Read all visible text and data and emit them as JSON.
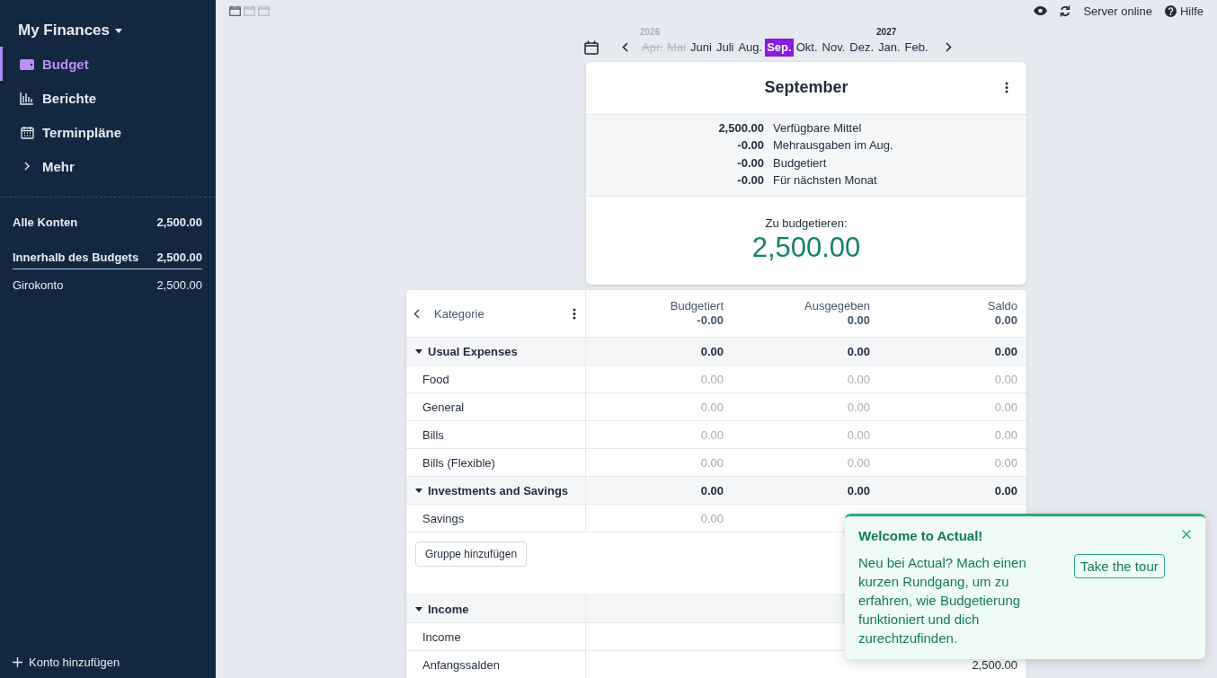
{
  "sidebar": {
    "title": "My Finances",
    "nav": [
      {
        "label": "Budget",
        "selected": true
      },
      {
        "label": "Berichte",
        "selected": false
      },
      {
        "label": "Terminpläne",
        "selected": false
      },
      {
        "label": "Mehr",
        "selected": false
      }
    ],
    "accounts": [
      {
        "name": "Alle Konten",
        "balance": "2,500.00",
        "kind": "total"
      },
      {
        "name": "Innerhalb des Budgets",
        "balance": "2,500.00",
        "kind": "group"
      },
      {
        "name": "Girokonto",
        "balance": "2,500.00",
        "kind": "account"
      }
    ],
    "add_account": "Konto hinzufügen"
  },
  "view_icons": [
    {
      "selected": true
    },
    {
      "selected": false
    },
    {
      "selected": false
    }
  ],
  "toolbar": {
    "server_status": "Server online",
    "help": "Hilfe"
  },
  "month_picker": {
    "months": [
      {
        "label": "Apr.",
        "year": "2026",
        "disabled": true,
        "selected": false
      },
      {
        "label": "Mai",
        "disabled": true,
        "selected": false
      },
      {
        "label": "Juni",
        "disabled": false,
        "selected": false
      },
      {
        "label": "Juli",
        "disabled": false,
        "selected": false
      },
      {
        "label": "Aug.",
        "disabled": false,
        "selected": false
      },
      {
        "label": "Sep.",
        "disabled": false,
        "selected": true
      },
      {
        "label": "Okt.",
        "disabled": false,
        "selected": false
      },
      {
        "label": "Nov.",
        "disabled": false,
        "selected": false
      },
      {
        "label": "Dez.",
        "disabled": false,
        "selected": false
      },
      {
        "label": "Jan.",
        "year": "2027",
        "disabled": false,
        "selected": false
      },
      {
        "label": "Feb.",
        "disabled": false,
        "selected": false
      }
    ]
  },
  "budget_summary": {
    "title": "September",
    "lines": [
      {
        "amount": "2,500.00",
        "label": "Verfügbare Mittel"
      },
      {
        "amount": "-0.00",
        "label": "Mehrausgaben im Aug."
      },
      {
        "amount": "-0.00",
        "label": "Budgetiert"
      },
      {
        "amount": "-0.00",
        "label": "Für nächsten Monat"
      }
    ],
    "to_budget_label": "Zu budgetieren:",
    "to_budget_amount": "2,500.00"
  },
  "table": {
    "category_header": "Kategorie",
    "columns": [
      {
        "label": "Budgetiert",
        "total": "-0.00"
      },
      {
        "label": "Ausgegeben",
        "total": "0.00"
      },
      {
        "label": "Saldo",
        "total": "0.00"
      }
    ],
    "expense_groups": [
      {
        "name": "Usual Expenses",
        "expanded": true,
        "budgeted": "0.00",
        "spent": "0.00",
        "balance": "0.00",
        "rows": [
          {
            "name": "Food",
            "budgeted": "0.00",
            "spent": "0.00",
            "balance": "0.00"
          },
          {
            "name": "General",
            "budgeted": "0.00",
            "spent": "0.00",
            "balance": "0.00"
          },
          {
            "name": "Bills",
            "budgeted": "0.00",
            "spent": "0.00",
            "balance": "0.00"
          },
          {
            "name": "Bills (Flexible)",
            "budgeted": "0.00",
            "spent": "0.00",
            "balance": "0.00"
          }
        ]
      },
      {
        "name": "Investments and Savings",
        "expanded": true,
        "budgeted": "0.00",
        "spent": "0.00",
        "balance": "0.00",
        "rows": [
          {
            "name": "Savings",
            "budgeted": "0.00"
          }
        ]
      }
    ],
    "add_group": "Gruppe hinzufügen",
    "income_groups": [
      {
        "name": "Income",
        "expanded": true,
        "rows": [
          {
            "name": "Income"
          },
          {
            "name": "Anfangssalden",
            "balance": "2,500.00"
          }
        ]
      }
    ]
  },
  "toast": {
    "title": "Welcome to Actual!",
    "message": "Neu bei Actual? Mach einen kurzen Rundgang, um zu erfahren, wie Budgetierung funktioniert und dich zurechtzufinden.",
    "action": "Take the tour"
  }
}
